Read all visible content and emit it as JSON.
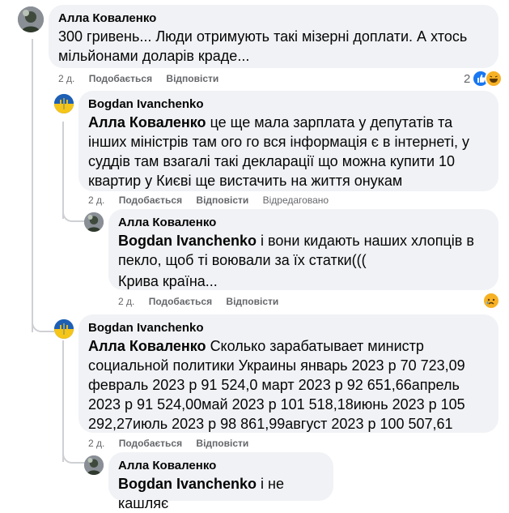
{
  "comments": [
    {
      "author": "Алла Коваленко",
      "text": "300 гривень... Люди отримують такі мізерні доплати. А хтось мільйонами доларів краде...",
      "time": "2 д.",
      "like": "Подобається",
      "reply": "Відповісти",
      "reaction_count": "2",
      "reaction_icons": [
        "like-icon",
        "haha-icon"
      ]
    },
    {
      "author": "Bogdan Ivanchenko",
      "mention": "Алла Коваленко",
      "text": "це ще мала зарплата у депутатів та інших міністрів там ого го вся інформація є в інтернеті, у суддів там взагалі такі декларації що можна купити 10 квартир у Києві ще вистачить на життя онукам",
      "time": "2 д.",
      "like": "Подобається",
      "reply": "Відповісти",
      "edited": "Відредаговано"
    },
    {
      "author": "Алла Коваленко",
      "mention": "Bogdan Ivanchenko",
      "text": "і вони кидають наших хлопців в пекло, щоб ті воювали за їх статки(((",
      "text2": "Крива країна...",
      "time": "2 д.",
      "like": "Подобається",
      "reply": "Відповісти",
      "reaction_icons": [
        "sad-icon"
      ]
    },
    {
      "author": "Bogdan Ivanchenko",
      "mention": "Алла Коваленко",
      "text": "Сколько зарабатывает министр социальной политики Украины январь 2023 р 70 723,09 февраль 2023 р 91 524,0 март 2023 р 92 651,66апрель 2023 р 91 524,00май 2023 р 101 518,18июнь 2023 р 105 292,27июль 2023 р 98 861,99август 2023 р 100 507,61",
      "time": "2 д.",
      "like": "Подобається",
      "reply": "Відповісти"
    },
    {
      "author": "Алла Коваленко",
      "mention": "Bogdan Ivanchenko",
      "text": "і не кашляє"
    }
  ],
  "colors": {
    "bubble": "#f0f2f5",
    "meta": "#65676b",
    "thread_line": "#ced0d4",
    "like_blue": "#1877f2",
    "reaction_yellow": "#f7b125"
  }
}
